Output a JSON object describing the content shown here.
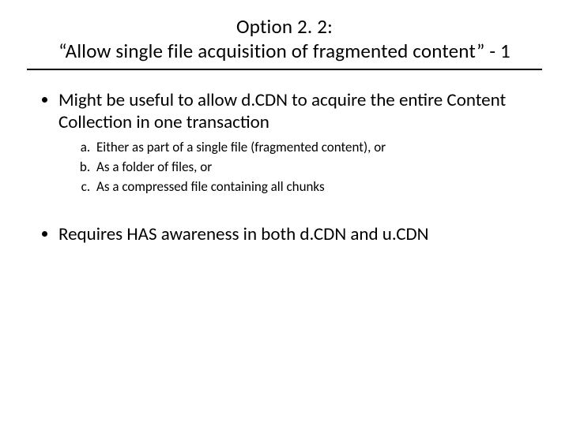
{
  "title": {
    "line1": "Option 2. 2:",
    "line2": "“Allow single file acquisition of fragmented content” - 1"
  },
  "bullets": [
    {
      "text": "Might be useful to allow d.CDN to acquire the entire Content Collection in one transaction",
      "sub": [
        "Either as part of a single file (fragmented content), or",
        "As a folder of files, or",
        "As a compressed file containing all chunks"
      ]
    },
    {
      "text": "Requires HAS awareness in both d.CDN and u.CDN",
      "sub": []
    }
  ]
}
